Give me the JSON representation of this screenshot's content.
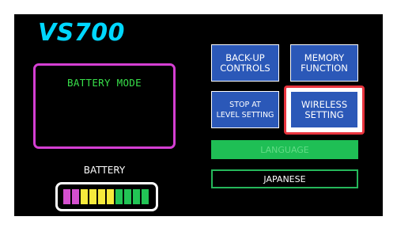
{
  "header": {
    "title": "VS700"
  },
  "mode_panel": {
    "text": "BATTERY MODE"
  },
  "battery": {
    "label": "BATTERY",
    "cell_colors": [
      "#d54fcf",
      "#d54fcf",
      "#f6ea3c",
      "#f6ea3c",
      "#f6ea3c",
      "#f6ea3c",
      "#22c455",
      "#22c455",
      "#22c455",
      "#22c455"
    ]
  },
  "buttons": {
    "backup": {
      "line1": "BACK-UP",
      "line2": "CONTROLS"
    },
    "memory": {
      "line1": "MEMORY",
      "line2": "FUNCTION"
    },
    "stop": {
      "line1": "STOP AT",
      "line2": "LEVEL SETTING"
    },
    "wireless": {
      "line1": "WIRELESS",
      "line2": "SETTING"
    }
  },
  "language": {
    "label": "LANGUAGE",
    "value": "JAPANESE"
  },
  "colors": {
    "background": "#000000",
    "title": "#00d7ff",
    "mode_border": "#d53fd3",
    "mode_text": "#38e04a",
    "button": "#2b58b8",
    "highlight": "#e8343e",
    "language_bar": "#1fbf55"
  }
}
